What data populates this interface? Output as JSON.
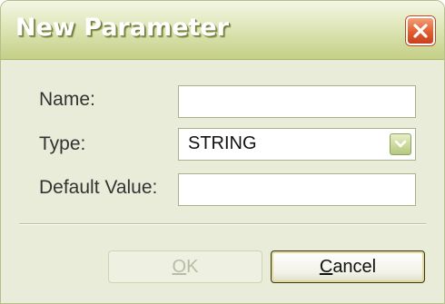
{
  "dialog": {
    "title": "New Parameter",
    "close_icon": "close-icon"
  },
  "form": {
    "name_label": "Name:",
    "name_value": "",
    "type_label": "Type:",
    "type_value": "STRING",
    "default_label": "Default Value:",
    "default_value": ""
  },
  "buttons": {
    "ok_mnemonic": "O",
    "ok_rest": "K",
    "ok_enabled": false,
    "cancel_mnemonic": "C",
    "cancel_rest": "ancel"
  },
  "colors": {
    "title_bar": "#c4cf86",
    "close_button": "#e25c2e",
    "body": "#e9ecd8"
  }
}
